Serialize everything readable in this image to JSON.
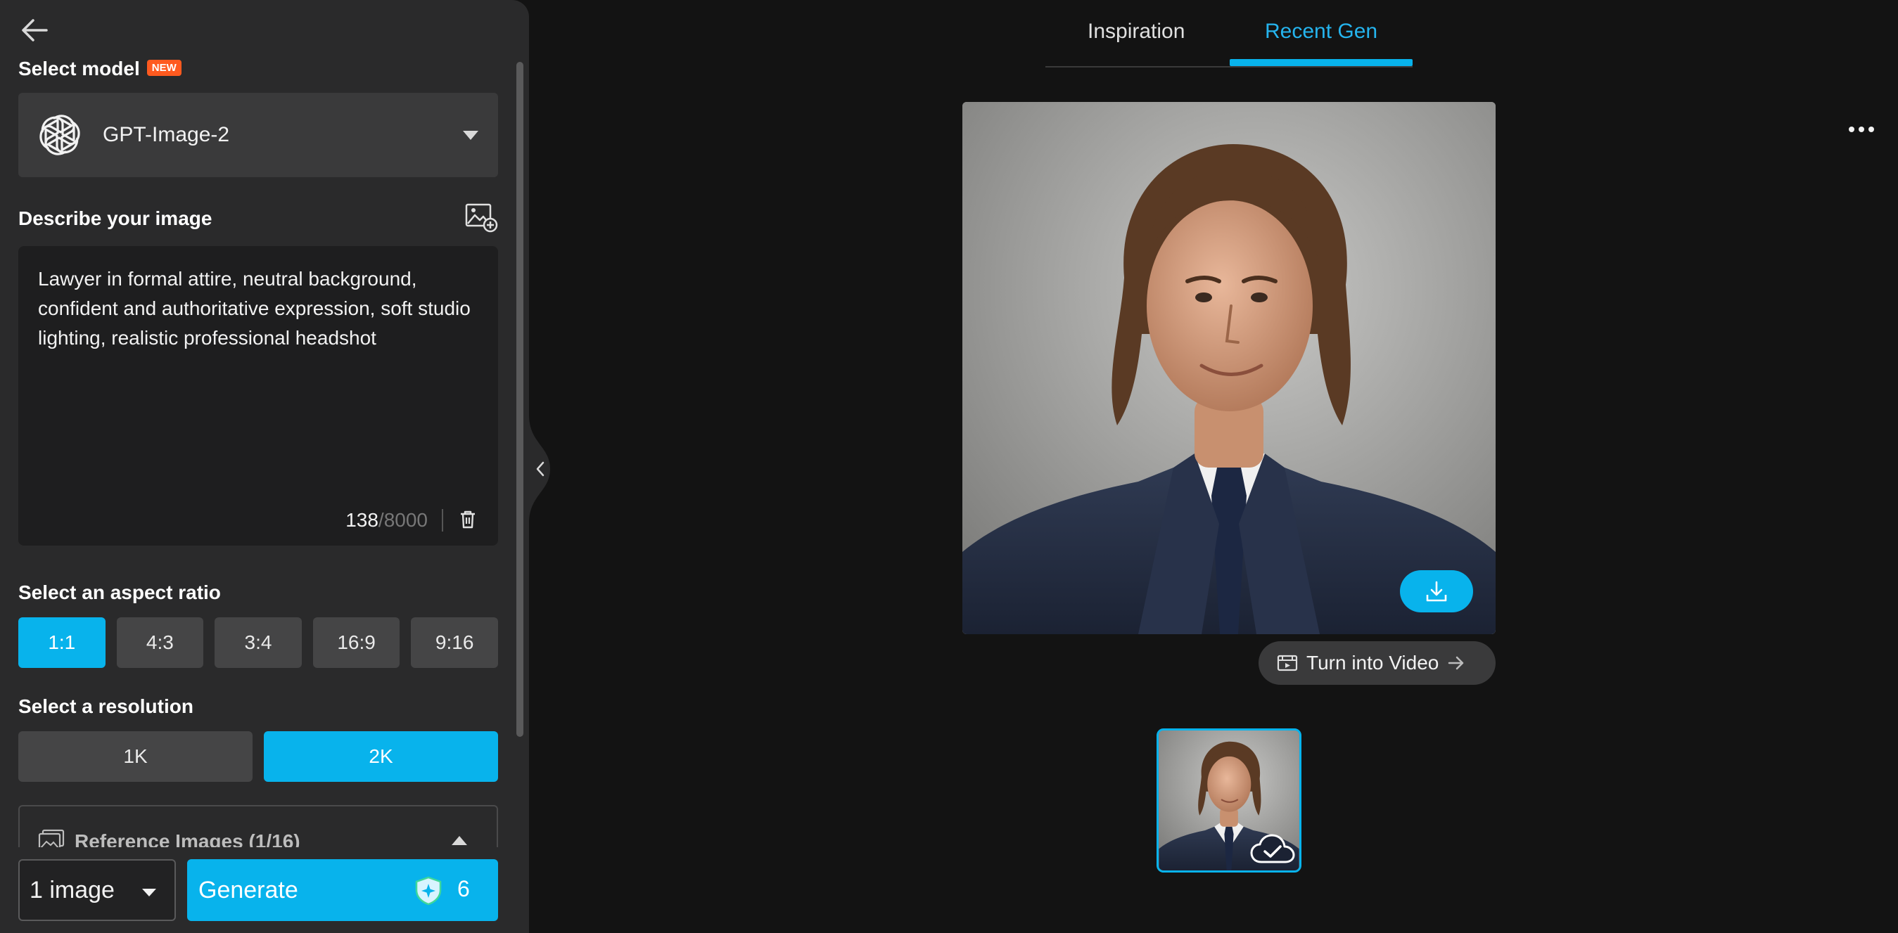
{
  "sidebar": {
    "model_label": "Select model",
    "new_badge": "NEW",
    "model_name": "GPT-Image-2",
    "describe_label": "Describe your image",
    "prompt_text": "Lawyer in formal attire, neutral background, confident and authoritative expression, soft studio lighting, realistic professional headshot",
    "char_count": "138",
    "char_max": "/8000",
    "aspect_label": "Select an aspect ratio",
    "aspect_ratios": [
      "1:1",
      "4:3",
      "3:4",
      "16:9",
      "9:16"
    ],
    "aspect_selected": "1:1",
    "resolution_label": "Select a resolution",
    "resolutions": [
      "1K",
      "2K"
    ],
    "resolution_selected": "2K",
    "reference_label": "Reference Images (1/16)",
    "image_count": "1 image",
    "generate_label": "Generate",
    "credit_cost": "6"
  },
  "tabs": {
    "inspiration": "Inspiration",
    "recent": "Recent Gen",
    "active": "Recent Gen"
  },
  "main": {
    "turn_video_label": "Turn into Video"
  },
  "colors": {
    "accent": "#08b3ec",
    "sidebar_bg": "#2a2a2b",
    "main_bg": "#131313",
    "new_badge": "#ff5a1f"
  }
}
